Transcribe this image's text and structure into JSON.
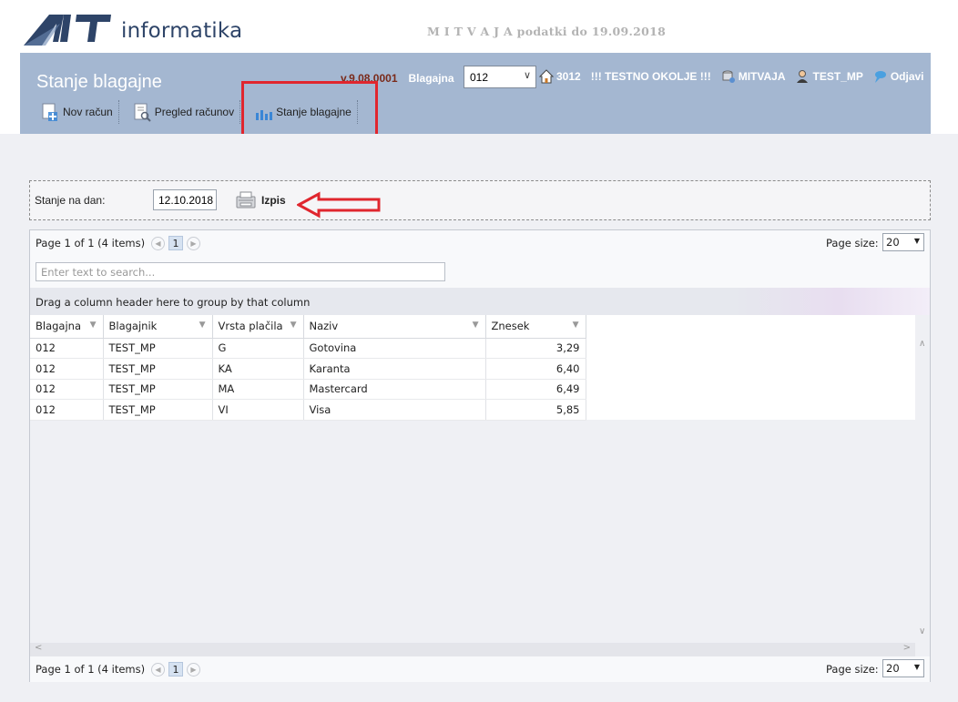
{
  "brand": {
    "logo_text": "informatika"
  },
  "top_info": "M I T V A J A podatki do 19.09.2018",
  "header": {
    "title": "Stanje blagajne",
    "version": "v.9.08.0001",
    "blagajna_label": "Blagajna",
    "blagajna_value": "012",
    "items": [
      {
        "icon": "home-icon",
        "label": "3012"
      },
      {
        "icon": "",
        "label": "!!! TESTNO OKOLJE !!!"
      },
      {
        "icon": "database-user-icon",
        "label": "MITVAJA"
      },
      {
        "icon": "user-icon",
        "label": "TEST_MP"
      },
      {
        "icon": "logout-icon",
        "label": "Odjavi"
      }
    ]
  },
  "toolbar": {
    "items": [
      {
        "icon": "new-document-icon",
        "label": "Nov račun"
      },
      {
        "icon": "document-search-icon",
        "label": "Pregled računov"
      },
      {
        "icon": "bar-chart-icon",
        "label": "Stanje blagajne"
      }
    ]
  },
  "filter": {
    "label": "Stanje na dan:",
    "date_value": "12.10.2018",
    "print_label": "Izpis"
  },
  "grid": {
    "pager_text": "Page 1 of 1 (4 items)",
    "current_page": "1",
    "page_size_label": "Page size:",
    "page_size_value": "20",
    "search_placeholder": "Enter text to search...",
    "group_hint": "Drag a column header here to group by that column",
    "columns": [
      "Blagajna",
      "Blagajnik",
      "Vrsta plačila",
      "Naziv",
      "Znesek"
    ],
    "rows": [
      [
        "012",
        "TEST_MP",
        "G",
        "Gotovina",
        "3,29"
      ],
      [
        "012",
        "TEST_MP",
        "KA",
        "Karanta",
        "6,40"
      ],
      [
        "012",
        "TEST_MP",
        "MA",
        "Mastercard",
        "6,49"
      ],
      [
        "012",
        "TEST_MP",
        "VI",
        "Visa",
        "5,85"
      ]
    ]
  },
  "colors": {
    "header_bg": "#a4b7d1",
    "highlight_red": "#e0262e",
    "logo_blue": "#2e4468"
  }
}
